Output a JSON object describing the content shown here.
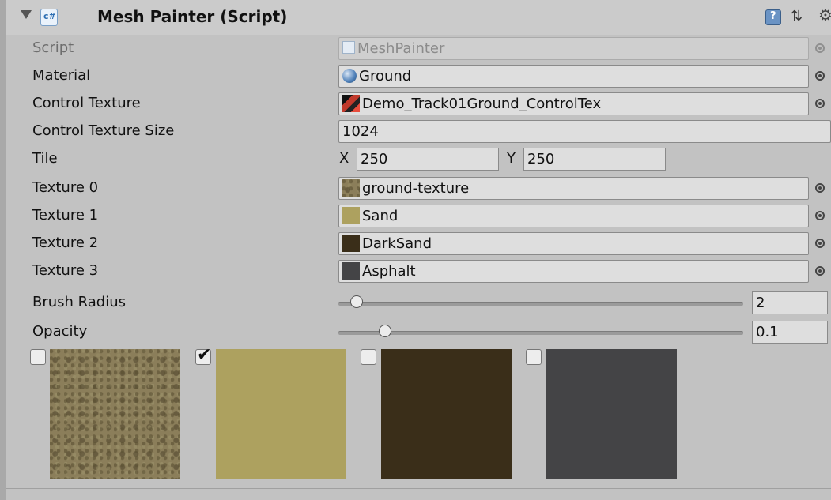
{
  "header": {
    "title": "Mesh Painter (Script)",
    "script_icon_label": "c#",
    "icons": [
      "foldout-arrow-icon",
      "csharp-script-icon",
      "help-icon",
      "preset-icon",
      "gear-icon"
    ]
  },
  "fields": {
    "script": {
      "label": "Script",
      "value": "MeshPainter"
    },
    "material": {
      "label": "Material",
      "value": "Ground"
    },
    "control_texture": {
      "label": "Control Texture",
      "value": "Demo_Track01Ground_ControlTex"
    },
    "control_texture_size": {
      "label": "Control Texture Size",
      "value": "1024"
    },
    "tile": {
      "label": "Tile",
      "x_label": "X",
      "x_value": "250",
      "y_label": "Y",
      "y_value": "250"
    },
    "texture0": {
      "label": "Texture 0",
      "value": "ground-texture",
      "color": "#8b7e5a"
    },
    "texture1": {
      "label": "Texture 1",
      "value": "Sand",
      "color": "#ada15f"
    },
    "texture2": {
      "label": "Texture 2",
      "value": "DarkSand",
      "color": "#3a2e19"
    },
    "texture3": {
      "label": "Texture 3",
      "value": "Asphalt",
      "color": "#444446"
    },
    "brush_radius": {
      "label": "Brush Radius",
      "value": "2",
      "slider_fraction": 0.03
    },
    "opacity": {
      "label": "Opacity",
      "value": "0.1",
      "slider_fraction": 0.1
    }
  },
  "texture_selector": {
    "items": [
      {
        "name": "ground-texture",
        "checked": false,
        "color": "#8b7e5a"
      },
      {
        "name": "Sand",
        "checked": true,
        "color": "#ada15f"
      },
      {
        "name": "DarkSand",
        "checked": false,
        "color": "#3a2e19"
      },
      {
        "name": "Asphalt",
        "checked": false,
        "color": "#444446"
      }
    ]
  },
  "colors": {
    "panel_bg": "#c2c2c2",
    "field_bg": "#dedede",
    "accent_blue": "#6a93c4"
  }
}
